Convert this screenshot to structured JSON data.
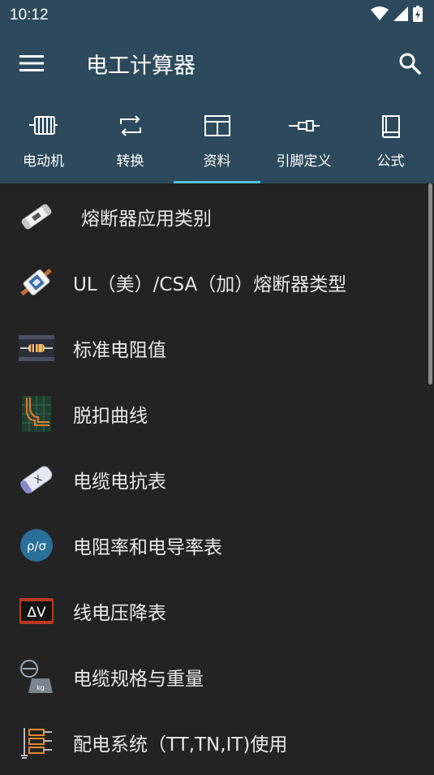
{
  "status": {
    "time": "10:12"
  },
  "app": {
    "title": "电工计算器"
  },
  "tabs": [
    {
      "label": "电动机",
      "icon": "motor-icon"
    },
    {
      "label": "转换",
      "icon": "convert-icon"
    },
    {
      "label": "资料",
      "icon": "data-table-icon",
      "active": true
    },
    {
      "label": "引脚定义",
      "icon": "connector-icon"
    },
    {
      "label": "公式",
      "icon": "book-icon"
    }
  ],
  "items": [
    {
      "label": "熔断器应用类别",
      "icon": "fuse-icon"
    },
    {
      "label": "UL（美）/CSA（加）熔断器类型",
      "icon": "ul-fuse-icon"
    },
    {
      "label": "标准电阻值",
      "icon": "resistor-icon"
    },
    {
      "label": "脱扣曲线",
      "icon": "trip-curve-icon"
    },
    {
      "label": "电缆电抗表",
      "icon": "cable-reactance-icon",
      "icon_text": "X"
    },
    {
      "label": "电阻率和电导率表",
      "icon": "resistivity-icon",
      "icon_text": "ρ/σ"
    },
    {
      "label": "线电压降表",
      "icon": "voltage-drop-icon",
      "icon_text": "ΔV"
    },
    {
      "label": "电缆规格与重量",
      "icon": "cable-weight-icon",
      "icon_text": "kg"
    },
    {
      "label": "配电系统（TT,TN,IT)使用",
      "icon": "distribution-system-icon"
    }
  ],
  "colors": {
    "appbar": "#2d4a5c",
    "accent": "#4fc3d9",
    "background": "#232323"
  }
}
